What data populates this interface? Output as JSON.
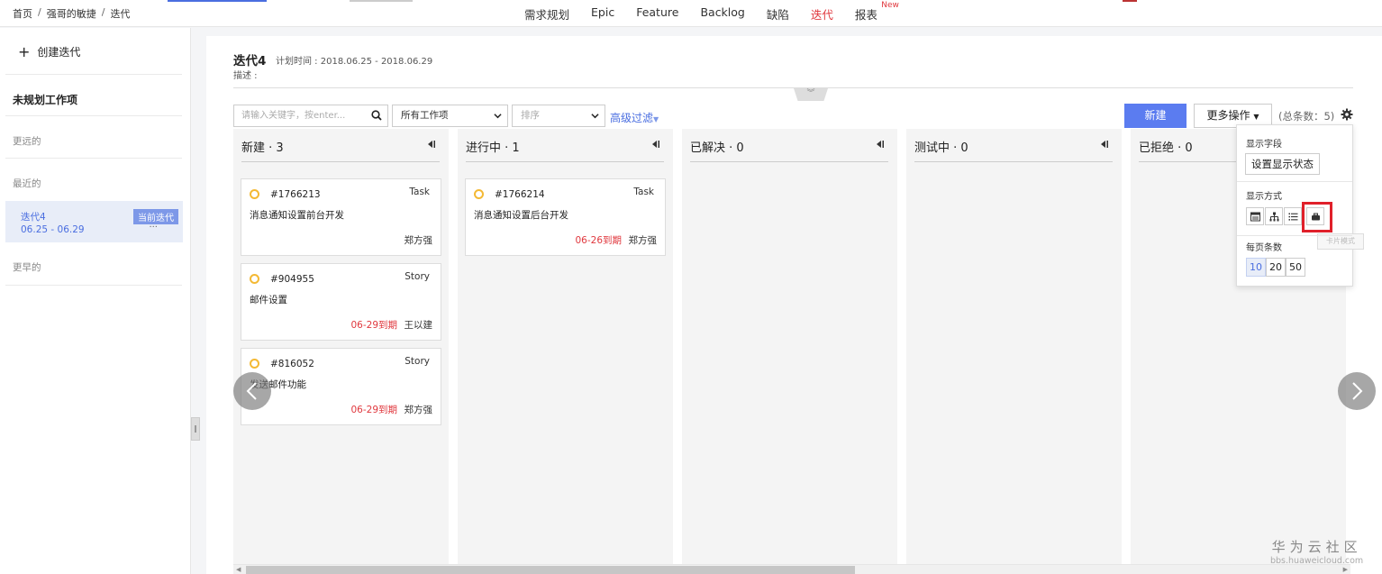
{
  "breadcrumb": [
    "首页",
    "强哥的敏捷",
    "迭代"
  ],
  "nav": {
    "items": [
      "需求规划",
      "Epic",
      "Feature",
      "Backlog",
      "缺陷",
      "迭代",
      "报表"
    ],
    "active": "迭代",
    "new_badge": "New"
  },
  "sidebar": {
    "create_label": "创建迭代",
    "unplanned": "未规划工作项",
    "group_far": "更远的",
    "group_recent": "最近的",
    "group_earlier": "更早的",
    "current_iteration": {
      "name": "迭代4",
      "dates": "06.25 - 06.29",
      "badge": "当前迭代",
      "more": "···"
    }
  },
  "header": {
    "title": "迭代4",
    "plan_time": "计划时间 : 2018.06.25 - 2018.06.29",
    "description": "描述 :"
  },
  "toolbar": {
    "search_placeholder": "请输入关键字，按enter...",
    "filter_value": "所有工作项",
    "sort_placeholder": "排序",
    "advanced_filter": "高级过滤",
    "new_button": "新建",
    "more_actions": "更多操作",
    "total": "(总条数：5)"
  },
  "columns": [
    {
      "title": "新建 · 3"
    },
    {
      "title": "进行中 · 1"
    },
    {
      "title": "已解决 · 0"
    },
    {
      "title": "测试中 · 0"
    },
    {
      "title": "已拒绝 · 0"
    }
  ],
  "cards": [
    {
      "id": "#1766213",
      "type": "Task",
      "title": "消息通知设置前台开发",
      "due": "",
      "owner": "郑方强"
    },
    {
      "id": "#904955",
      "type": "Story",
      "title": "邮件设置",
      "due": "06-29到期",
      "owner": "王以建"
    },
    {
      "id": "#816052",
      "type": "Story",
      "title": "发送邮件功能",
      "due": "06-29到期",
      "owner": "郑方强"
    },
    {
      "id": "#1766214",
      "type": "Task",
      "title": "消息通知设置后台开发",
      "due": "06-26到期",
      "owner": "郑方强"
    }
  ],
  "settings_popup": {
    "display_fields": "显示字段",
    "set_status": "设置显示状态",
    "display_mode": "显示方式",
    "tooltip": "卡片模式",
    "page_size_label": "每页条数",
    "page_sizes": [
      "10",
      "20",
      "50"
    ],
    "active_page_size": "10"
  },
  "watermark": {
    "line1": "华为云社区",
    "line2": "bbs.huaweicloud.com"
  },
  "colors": {
    "primary": "#5b7cf0",
    "accent_red": "#e0383e",
    "status_dot": "#f4b934",
    "highlight": "#e0202a"
  }
}
